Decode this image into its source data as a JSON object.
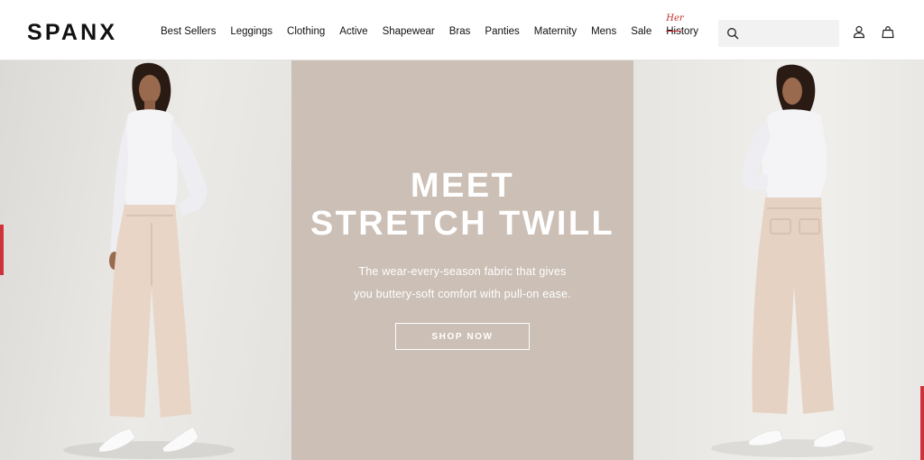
{
  "brand": {
    "logo_text": "SPANX"
  },
  "nav": {
    "items": [
      {
        "label": "Best Sellers"
      },
      {
        "label": "Leggings"
      },
      {
        "label": "Clothing"
      },
      {
        "label": "Active"
      },
      {
        "label": "Shapewear"
      },
      {
        "label": "Bras"
      },
      {
        "label": "Panties"
      },
      {
        "label": "Maternity"
      },
      {
        "label": "Mens"
      },
      {
        "label": "Sale"
      }
    ],
    "history": {
      "strike": "His",
      "rest": "tory",
      "annotation": "Her"
    }
  },
  "search": {
    "value": "",
    "placeholder": "",
    "icon": "search-icon"
  },
  "header_icons": {
    "account": "account-icon",
    "bag": "shopping-bag-icon"
  },
  "hero": {
    "title_line1": "MEET",
    "title_line2": "STRETCH TWILL",
    "subtitle_line1": "The wear-every-season fabric that gives",
    "subtitle_line2": "you buttery-soft comfort with pull-on ease.",
    "cta_label": "SHOP NOW"
  },
  "colors": {
    "hero_center_bg": "#cbbfb6",
    "accent_red": "#d0323a",
    "text_dark": "#111111",
    "search_bg": "#f2f2f2"
  }
}
